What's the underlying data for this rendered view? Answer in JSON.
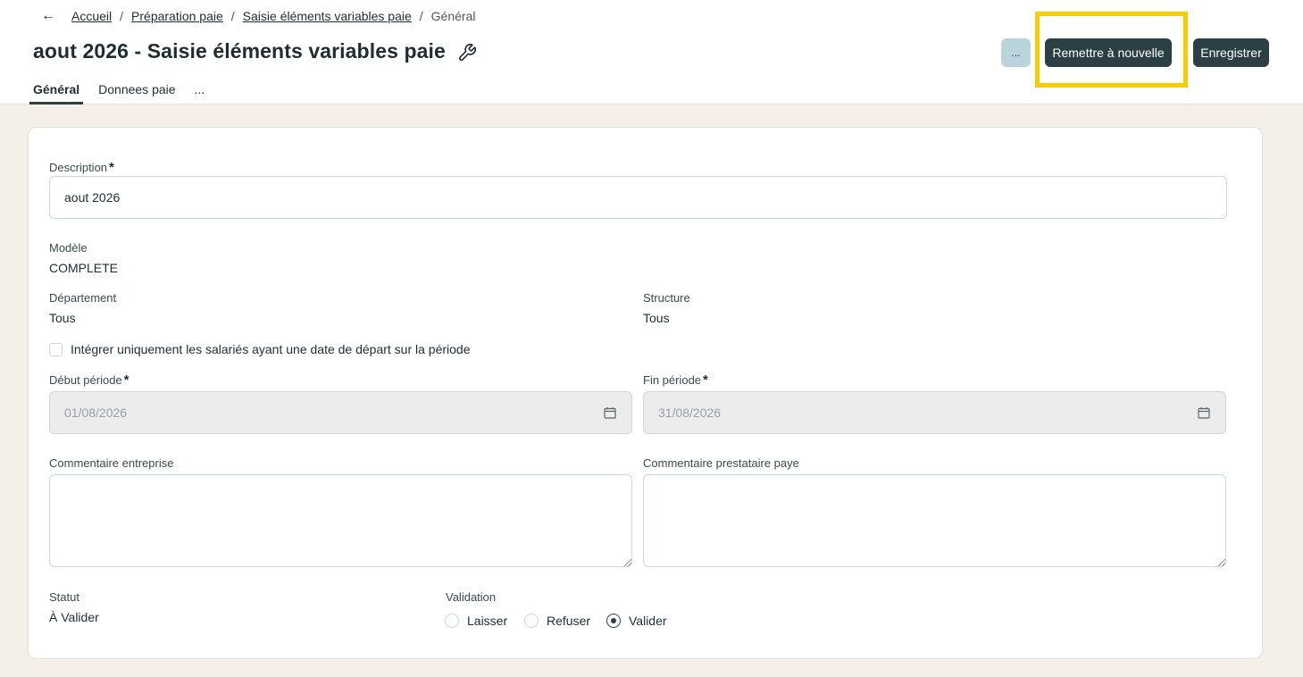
{
  "breadcrumb": {
    "back_icon": "arrow-left-icon",
    "items": [
      "Accueil",
      "Préparation paie",
      "Saisie éléments variables paie"
    ],
    "separator": "/",
    "current": "Général"
  },
  "page": {
    "title": "aout 2026 - Saisie éléments variables paie",
    "title_icon": "wrench-icon"
  },
  "tabs": [
    {
      "label": "Général",
      "active": true
    },
    {
      "label": "Donnees paie",
      "active": false
    },
    {
      "label": "...",
      "active": false
    }
  ],
  "toolbar": {
    "more_label": "...",
    "reset_label": "Remettre à nouvelle",
    "save_label": "Enregistrer",
    "primary_color": "#2b3f45",
    "secondary_color": "#b9d4dc",
    "highlight_color": "#f7cc00"
  },
  "form": {
    "description": {
      "label": "Description",
      "required_mark": "*",
      "value": "aout 2026"
    },
    "modele": {
      "label": "Modèle",
      "value": "COMPLETE"
    },
    "departement": {
      "label": "Département",
      "value": "Tous"
    },
    "structure": {
      "label": "Structure",
      "value": "Tous"
    },
    "checkbox_depart": {
      "label": "Intégrer uniquement les salariés ayant une date de départ sur la période",
      "checked": false
    },
    "debut_periode": {
      "label": "Début période",
      "required_mark": "*",
      "value": "01/08/2026",
      "icon": "calendar-icon"
    },
    "fin_periode": {
      "label": "Fin période",
      "required_mark": "*",
      "value": "31/08/2026",
      "icon": "calendar-icon"
    },
    "commentaire_entreprise": {
      "label": "Commentaire entreprise",
      "value": ""
    },
    "commentaire_prestataire": {
      "label": "Commentaire prestataire paye",
      "value": ""
    },
    "statut": {
      "label": "Statut",
      "value": "À Valider"
    },
    "validation": {
      "label": "Validation",
      "options": [
        "Laisser",
        "Refuser",
        "Valider"
      ],
      "selected": "Valider"
    }
  }
}
